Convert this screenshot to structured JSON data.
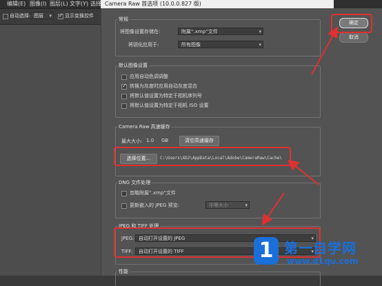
{
  "menubar": {
    "items": [
      "编辑(E)",
      "图像(I)",
      "图层(L)",
      "文字(Y)",
      "选择"
    ]
  },
  "options_bar": {
    "auto_select_label": "自动选择:",
    "auto_select_value": "图层",
    "show_transform_label": "显示变换控件"
  },
  "dialog": {
    "title": "Camera Raw 首选项 (10.0.0.827 版)",
    "general": {
      "legend": "常规",
      "save_settings_label": "将图像设置存储在:",
      "save_settings_value": "附属“.xmp”文件",
      "sharpen_label": "将锐化应用于:",
      "sharpen_value": "所有图像"
    },
    "default_settings": {
      "legend": "默认图像设置",
      "options": [
        {
          "label": "应用自动色调调整",
          "checked": false
        },
        {
          "label": "转换为灰度时应用自动灰度混合",
          "checked": true
        },
        {
          "label": "将默认值设置为特定于相机序列号",
          "checked": false
        },
        {
          "label": "将默认值设置为特定于相机 ISO 设置",
          "checked": false
        }
      ]
    },
    "cache": {
      "legend": "Camera Raw 高速缓存",
      "max_size_label": "最大大小:",
      "max_size_value": "1.0",
      "unit": "GB",
      "purge_button": "清空高速缓存",
      "select_location_button": "选择位置...",
      "path": "C:\\Users\\XD2\\AppData\\Local\\Adobe\\CameraRaw\\Cache\\"
    },
    "dng": {
      "legend": "DNG 文件处理",
      "ignore_sidecar_label": "忽略附属“.xmp”文件",
      "update_preview_label": "更新嵌入的 JPEG 预览:",
      "preview_size_value": "中等大小"
    },
    "jpeg_tiff": {
      "legend": "JPEG 和 TIFF 处理",
      "jpeg_label": "JPEG:",
      "jpeg_value": "自动打开设置的 JPEG",
      "tiff_label": "TIFF:",
      "tiff_value": "自动打开设置的 TIFF"
    },
    "performance": {
      "legend": "性能"
    },
    "ok_button": "确定",
    "cancel_button": "取消"
  },
  "watermark": {
    "logo_char": "1",
    "text": "第一自学网",
    "url": "www.d1qu.com"
  },
  "colors": {
    "annotation_red": "#e03030",
    "watermark_blue": "#1a6fd8"
  }
}
